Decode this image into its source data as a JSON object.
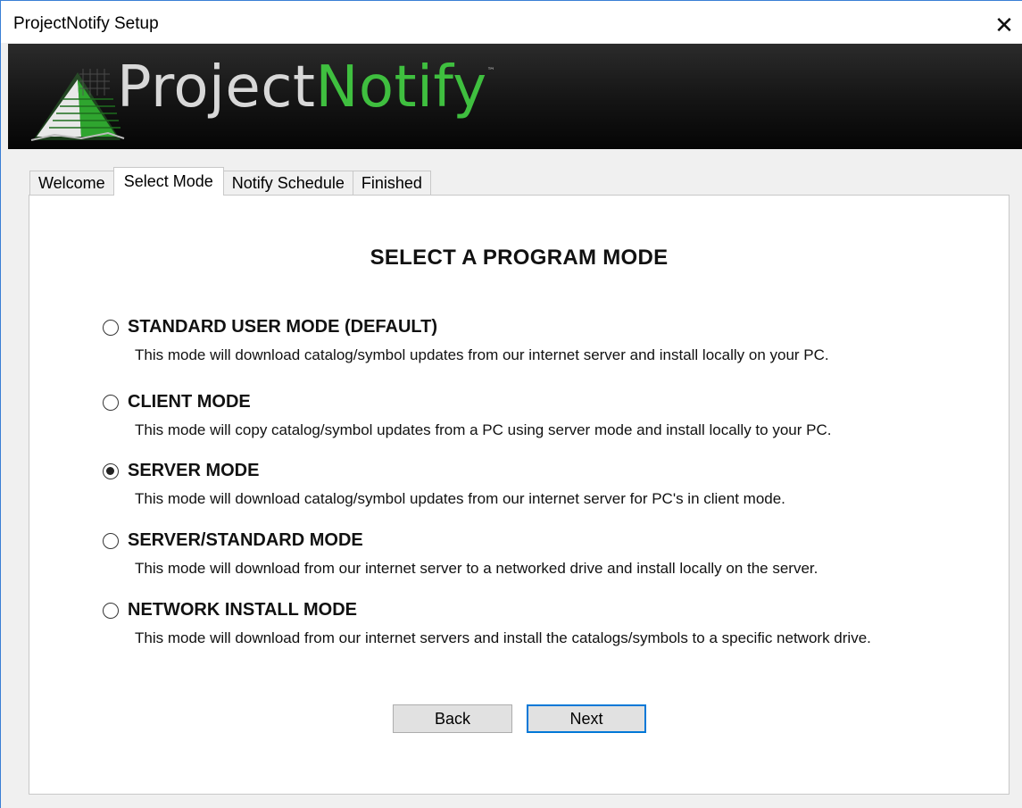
{
  "window": {
    "title": "ProjectNotify Setup",
    "close_glyph": "✕"
  },
  "banner": {
    "logo_part1": "Project",
    "logo_part2": "Notify",
    "trademark": "™",
    "logo_icon": "projectnotify-logo-icon"
  },
  "tabs": [
    {
      "label": "Welcome",
      "active": false
    },
    {
      "label": "Select Mode",
      "active": true
    },
    {
      "label": "Notify Schedule",
      "active": false
    },
    {
      "label": "Finished",
      "active": false
    }
  ],
  "main": {
    "heading": "SELECT A PROGRAM MODE",
    "options": [
      {
        "label": "STANDARD USER MODE (DEFAULT)",
        "description": "This mode will download catalog/symbol updates from our internet server and install locally on your PC.",
        "selected": false
      },
      {
        "label": "CLIENT MODE",
        "description": "This mode will copy catalog/symbol updates from a PC using server mode and install locally to your PC.",
        "selected": false
      },
      {
        "label": "SERVER MODE",
        "description": "This mode will download catalog/symbol updates from our internet server for PC's in client mode.",
        "selected": true
      },
      {
        "label": "SERVER/STANDARD MODE",
        "description": "This mode will download from our internet server to a networked drive and install locally on the server.",
        "selected": false
      },
      {
        "label": "NETWORK INSTALL MODE",
        "description": "This mode will download from our internet servers and install the catalogs/symbols to a specific network drive.",
        "selected": false
      }
    ]
  },
  "buttons": {
    "back_label": "Back",
    "next_label": "Next"
  },
  "colors": {
    "accent": "#0078d7",
    "logo_green": "#3fbf3f",
    "banner_bg": "#141414"
  }
}
